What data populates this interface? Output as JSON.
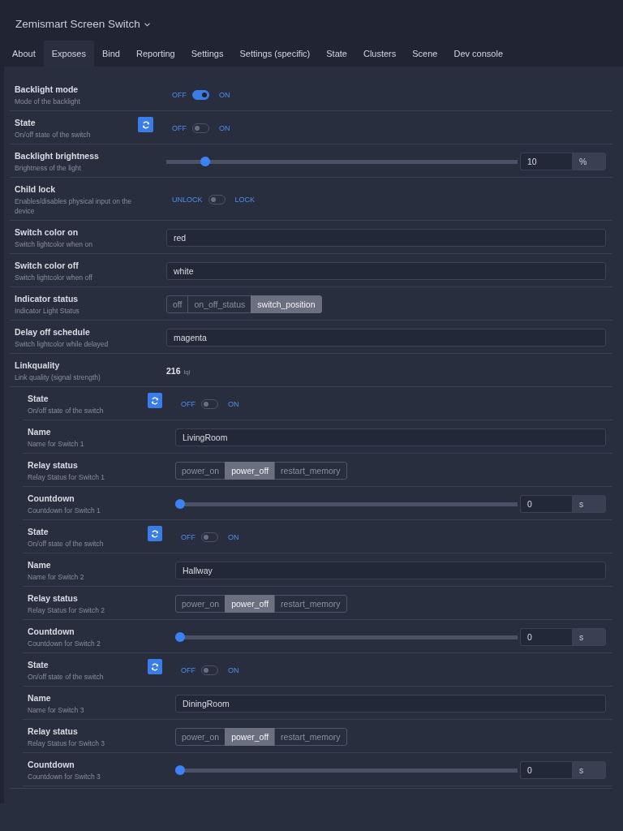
{
  "device": {
    "title": "Zemismart Screen Switch"
  },
  "tabs": [
    {
      "label": "About",
      "selected": false
    },
    {
      "label": "Exposes",
      "selected": true
    },
    {
      "label": "Bind",
      "selected": false
    },
    {
      "label": "Reporting",
      "selected": false
    },
    {
      "label": "Settings",
      "selected": false
    },
    {
      "label": "Settings (specific)",
      "selected": false
    },
    {
      "label": "State",
      "selected": false
    },
    {
      "label": "Clusters",
      "selected": false
    },
    {
      "label": "Scene",
      "selected": false
    },
    {
      "label": "Dev console",
      "selected": false
    }
  ],
  "features": [
    {
      "kind": "toggle",
      "label": "Backlight mode",
      "description": "Mode of the backlight",
      "refresh": false,
      "off_label": "OFF",
      "on_label": "ON",
      "on": true
    },
    {
      "kind": "toggle",
      "label": "State",
      "description": "On/off state of the switch",
      "refresh": true,
      "off_label": "OFF",
      "on_label": "ON",
      "on": false
    },
    {
      "kind": "slider",
      "label": "Backlight brightness",
      "description": "Brightness of the light",
      "level": 0.1,
      "value": "10",
      "unit": "%"
    },
    {
      "kind": "toggle",
      "label": "Child lock",
      "description": "Enables/disables physical input on the device",
      "refresh": false,
      "off_label": "UNLOCK",
      "on_label": "LOCK",
      "on": false
    },
    {
      "kind": "text",
      "label": "Switch color on",
      "description": "Switch lightcolor when on",
      "value": "red"
    },
    {
      "kind": "text",
      "label": "Switch color off",
      "description": "Switch lightcolor when off",
      "value": "white"
    },
    {
      "kind": "enum",
      "label": "Indicator status",
      "description": "Indicator Light Status",
      "options": [
        {
          "label": "off",
          "selected": false
        },
        {
          "label": "on_off_status",
          "selected": false
        },
        {
          "label": "switch_position",
          "selected": true
        }
      ]
    },
    {
      "kind": "text",
      "label": "Delay off schedule",
      "description": "Switch lightcolor while delayed",
      "value": "magenta"
    },
    {
      "kind": "reading",
      "label": "Linkquality",
      "description": "Link quality (signal strength)",
      "value": "216",
      "unit": "lqi"
    }
  ],
  "endpoints": [
    {
      "features": [
        {
          "kind": "toggle",
          "label": "State",
          "description": "On/off state of the switch",
          "refresh": true,
          "off_label": "OFF",
          "on_label": "ON",
          "on": false
        },
        {
          "kind": "text",
          "label": "Name",
          "description": "Name for Switch 1",
          "value": "LivingRoom"
        },
        {
          "kind": "enum",
          "label": "Relay status",
          "description": "Relay Status for Switch 1",
          "options": [
            {
              "label": "power_on",
              "selected": false
            },
            {
              "label": "power_off",
              "selected": true
            },
            {
              "label": "restart_memory",
              "selected": false
            }
          ]
        },
        {
          "kind": "slider",
          "label": "Countdown",
          "description": "Countdown for Switch 1",
          "level": 0,
          "value": "0",
          "unit": "s"
        }
      ]
    },
    {
      "features": [
        {
          "kind": "toggle",
          "label": "State",
          "description": "On/off state of the switch",
          "refresh": true,
          "off_label": "OFF",
          "on_label": "ON",
          "on": false
        },
        {
          "kind": "text",
          "label": "Name",
          "description": "Name for Switch 2",
          "value": "Hallway"
        },
        {
          "kind": "enum",
          "label": "Relay status",
          "description": "Relay Status for Switch 2",
          "options": [
            {
              "label": "power_on",
              "selected": false
            },
            {
              "label": "power_off",
              "selected": true
            },
            {
              "label": "restart_memory",
              "selected": false
            }
          ]
        },
        {
          "kind": "slider",
          "label": "Countdown",
          "description": "Countdown for Switch 2",
          "level": 0,
          "value": "0",
          "unit": "s"
        }
      ]
    },
    {
      "features": [
        {
          "kind": "toggle",
          "label": "State",
          "description": "On/off state of the switch",
          "refresh": true,
          "off_label": "OFF",
          "on_label": "ON",
          "on": false
        },
        {
          "kind": "text",
          "label": "Name",
          "description": "Name for Switch 3",
          "value": "DiningRoom"
        },
        {
          "kind": "enum",
          "label": "Relay status",
          "description": "Relay Status for Switch 3",
          "options": [
            {
              "label": "power_on",
              "selected": false
            },
            {
              "label": "power_off",
              "selected": true
            },
            {
              "label": "restart_memory",
              "selected": false
            }
          ]
        },
        {
          "kind": "slider",
          "label": "Countdown",
          "description": "Countdown for Switch 3",
          "level": 0,
          "value": "0",
          "unit": "s"
        }
      ]
    }
  ]
}
